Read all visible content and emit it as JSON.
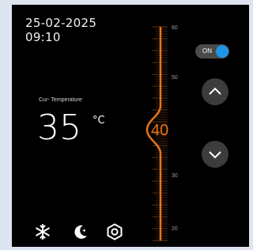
{
  "header": {
    "date": "25-02-2025",
    "time": "09:10"
  },
  "current": {
    "label": "Cur- Temperature",
    "value": "35",
    "unit": "°C"
  },
  "setpoint": {
    "value": "40",
    "scale_min": 20,
    "scale_max": 60
  },
  "scale": {
    "labels": [
      "60",
      "50",
      "40",
      "30",
      "20"
    ]
  },
  "power": {
    "label": "ON",
    "state": "on"
  },
  "colors": {
    "accent": "#e8731c",
    "toggle": "#1e96e6",
    "panel": "#000000"
  },
  "icons": [
    "snowflake-icon",
    "moon-star-icon",
    "hexagon-power-icon",
    "chevron-up-icon",
    "chevron-down-icon"
  ]
}
